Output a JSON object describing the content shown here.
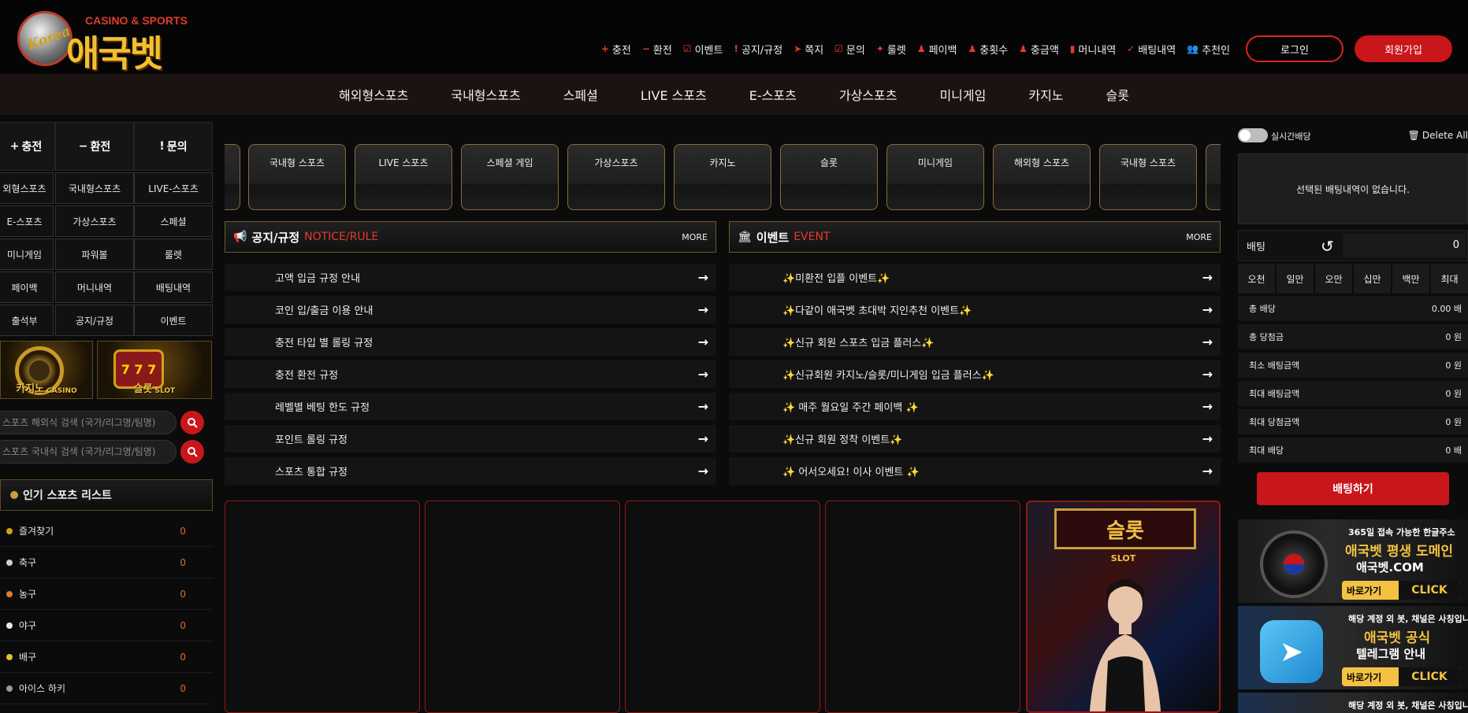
{
  "header": {
    "logo_sub": "CASINO & SPORTS",
    "logo_main": "애국벳",
    "logo_ball_text": "Korea",
    "links": [
      {
        "icon": "+",
        "label": "충전"
      },
      {
        "icon": "−",
        "label": "환전"
      },
      {
        "icon": "☑",
        "label": "이벤트"
      },
      {
        "icon": "!",
        "label": "공지/규정"
      },
      {
        "icon": "➤",
        "label": "쪽지"
      },
      {
        "icon": "☑",
        "label": "문의"
      },
      {
        "icon": "✦",
        "label": "룰렛"
      },
      {
        "icon": "♟",
        "label": "페이백"
      },
      {
        "icon": "♟",
        "label": "충횟수"
      },
      {
        "icon": "♟",
        "label": "충금액"
      },
      {
        "icon": "▮",
        "label": "머니내역"
      },
      {
        "icon": "✓",
        "label": "배팅내역"
      },
      {
        "icon": "👥",
        "label": "추천인"
      }
    ],
    "login": "로그인",
    "join": "회원가입"
  },
  "main_nav": [
    "해외형스포츠",
    "국내형스포츠",
    "스페셜",
    "LIVE 스포츠",
    "E-스포츠",
    "가상스포츠",
    "미니게임",
    "카지노",
    "슬롯"
  ],
  "left": {
    "quick": [
      {
        "icon": "+",
        "label": "충전"
      },
      {
        "icon": "−",
        "label": "환전"
      },
      {
        "icon": "!",
        "label": "문의"
      }
    ],
    "grid": [
      [
        "외형스포츠",
        "국내형스포츠",
        "LIVE-스포츠"
      ],
      [
        "E-스포츠",
        "가상스포츠",
        "스페셜"
      ],
      [
        "미니게임",
        "파워볼",
        "룰렛"
      ],
      [
        "페이백",
        "머니내역",
        "배팅내역"
      ],
      [
        "출석부",
        "공지/규정",
        "이벤트"
      ]
    ],
    "banner_casino": "카지노",
    "banner_casino_en": "CASINO",
    "banner_slot": "슬롯",
    "banner_slot_en": "SLOT",
    "search1_placeholder": "스포츠 해외식 검색 (국가/리그명/팀명)",
    "search2_placeholder": "스포츠 국내식 검색 (국가/리그명/팀명)",
    "popular_title": "인기 스포츠 리스트",
    "sports": [
      {
        "name": "즐겨찾기",
        "count": "0",
        "color": "#d4a017"
      },
      {
        "name": "축구",
        "count": "0",
        "color": "#cfcfcf"
      },
      {
        "name": "농구",
        "count": "0",
        "color": "#e07a2a"
      },
      {
        "name": "야구",
        "count": "0",
        "color": "#e8e8e8"
      },
      {
        "name": "배구",
        "count": "0",
        "color": "#e6c030"
      },
      {
        "name": "아이스 하키",
        "count": "0",
        "color": "#999999"
      }
    ]
  },
  "categories": [
    "국내형 스포츠",
    "LIVE 스포츠",
    "스페셜 게임",
    "가상스포츠",
    "카지노",
    "슬롯",
    "미니게임",
    "해외형 스포츠",
    "국내형 스포츠"
  ],
  "notice": {
    "title": "공지/규정",
    "title_en": "NOTICE/RULE",
    "more": "MORE",
    "items": [
      "고액 입금 규정 안내",
      "코인 입/출금 이용 안내",
      "충전 타입 별 롤링 규정",
      "충전 환전 규정",
      "레벨별 베팅 한도 규정",
      "포인트 롤링 규정",
      "스포츠 통합 규정"
    ]
  },
  "event": {
    "title": "이벤트",
    "title_en": "EVENT",
    "more": "MORE",
    "items": [
      "✨미환전 입플 이벤트✨",
      "✨다같이 애국벳 초대박 지인추천 이벤트✨",
      "✨신규 회원 스포츠 입금 플러스✨",
      "✨신규회원 카지노/슬롯/미니게임 입금 플러스✨",
      "✨ 매주 월요일 주간 페이백 ✨",
      "✨신규 회원 정착 이벤트✨",
      "✨ 어서오세요! 이사 이벤트 ✨"
    ]
  },
  "slot_banner": {
    "title": "슬롯",
    "sub": "SLOT"
  },
  "betslip": {
    "realtime": "실시간배당",
    "delete_all": "Delete All",
    "empty": "선택된 배팅내역이 없습니다.",
    "bet_label": "배팅",
    "bet_value": "0",
    "amounts": [
      "오천",
      "일만",
      "오만",
      "십만",
      "백만",
      "최대"
    ],
    "summary": [
      {
        "label": "총 배당",
        "value": "0.00 배"
      },
      {
        "label": "총 당첨금",
        "value": "0 원"
      },
      {
        "label": "최소 배팅금액",
        "value": "0 원"
      },
      {
        "label": "최대 배팅금액",
        "value": "0 원"
      },
      {
        "label": "최대 당첨금액",
        "value": "0 원"
      },
      {
        "label": "최대 배당",
        "value": "0 배"
      }
    ],
    "bet_button": "배팅하기"
  },
  "ad1": {
    "l1": "365일 접속 가능한 한글주소",
    "l2": "애국벳 평생 도메인",
    "l3": "애국벳.COM",
    "go": "바로가기",
    "click": "CLICK"
  },
  "ad2": {
    "l1": "해당 계정 외 봇, 채널은 사칭입니다.",
    "l2": "애국벳 공식",
    "l3": "텔레그램 안내",
    "go": "바로가기",
    "click": "CLICK"
  },
  "ad3": {
    "l1": "해당 계정 외 봇, 채널은 사칭입니다."
  }
}
